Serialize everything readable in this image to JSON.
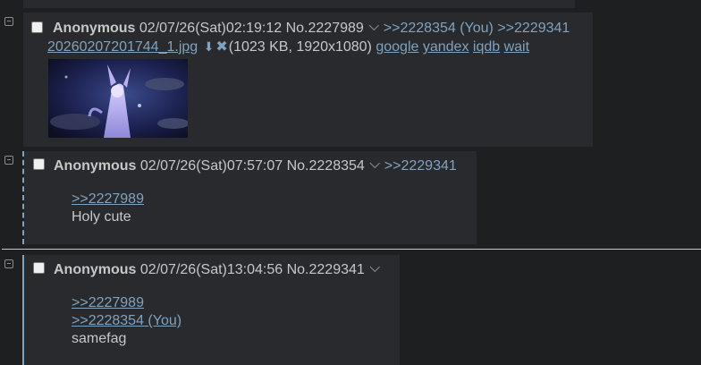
{
  "posts": [
    {
      "name": "Anonymous",
      "datetime": "02/07/26(Sat)02:19:12",
      "number": "No.2227989",
      "backlinks": [
        ">>2228354 (You)",
        ">>2229341"
      ],
      "file": {
        "filename": "20260207201744_1.jpg",
        "meta": "(1023 KB, 1920x1080)",
        "search_links": [
          "google",
          "yandex",
          "iqdb",
          "wait"
        ]
      }
    },
    {
      "name": "Anonymous",
      "datetime": "02/07/26(Sat)07:57:07",
      "number": "No.2228354",
      "backlinks": [
        ">>2229341"
      ],
      "quote_links": [
        ">>2227989"
      ],
      "message": "Holy cute"
    },
    {
      "name": "Anonymous",
      "datetime": "02/07/26(Sat)13:04:56",
      "number": "No.2229341",
      "quote_links": [
        ">>2227989",
        ">>2228354 (You)"
      ],
      "message": "samefag"
    }
  ],
  "colors": {
    "background": "#1d1f21",
    "post_background": "#282a2e",
    "text": "#c5c8c6",
    "link": "#81a2be"
  },
  "icons": [
    "minus-square-icon",
    "download-icon",
    "close-icon",
    "chevron-down-icon"
  ]
}
